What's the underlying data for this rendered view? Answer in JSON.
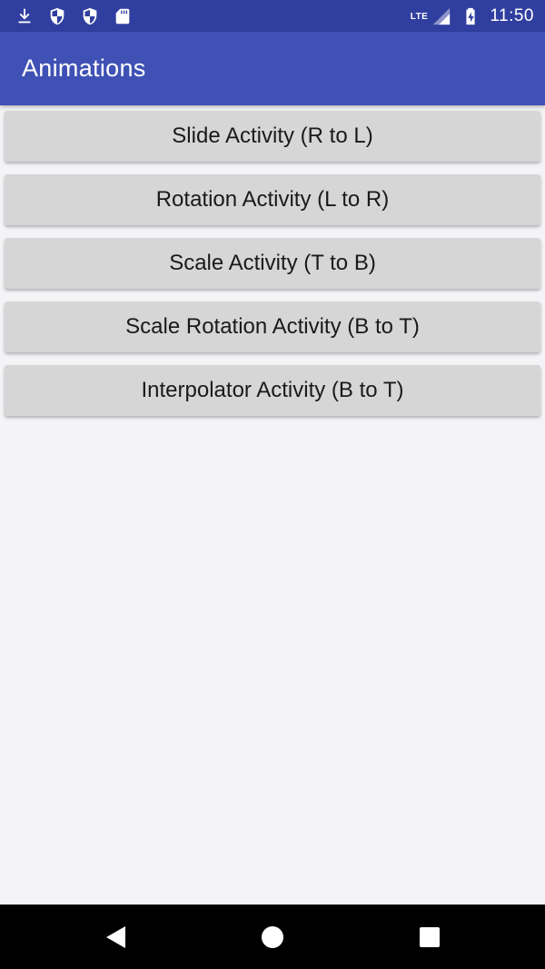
{
  "status_bar": {
    "icons_left": [
      "download-icon",
      "shield-icon",
      "shield-icon",
      "sd-card-icon"
    ],
    "network": "LTE",
    "time": "11:50",
    "color": "#303f9f"
  },
  "app_bar": {
    "title": "Animations",
    "color": "#3f51b5"
  },
  "buttons": [
    {
      "label": "Slide Activity (R to L)"
    },
    {
      "label": "Rotation Activity (L to R)"
    },
    {
      "label": "Scale Activity (T to B)"
    },
    {
      "label": "Scale Rotation Activity (B to T)"
    },
    {
      "label": "Interpolator Activity (B to T)"
    }
  ],
  "nav_bar": {
    "icons": [
      "back-icon",
      "home-icon",
      "recents-icon"
    ]
  }
}
